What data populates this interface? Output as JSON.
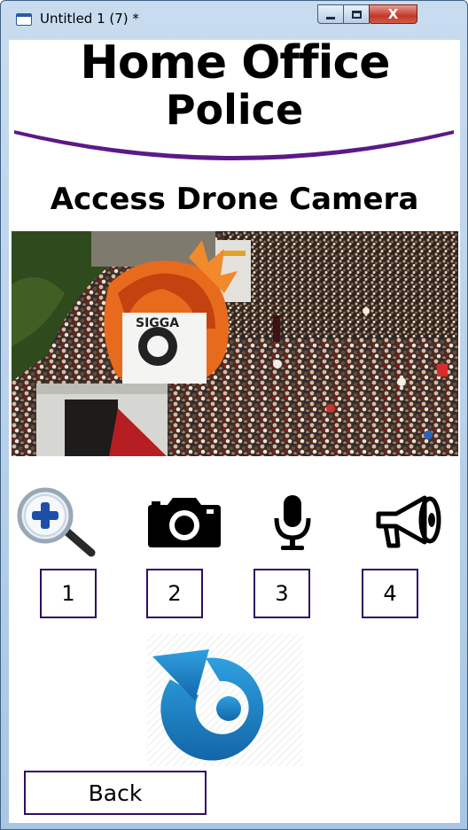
{
  "window": {
    "title": "Untitled 1 (7) *",
    "close_glyph": "X"
  },
  "header": {
    "brand_line1": "Home Office",
    "brand_line2": "Police",
    "swoosh_color": "#5b1a86"
  },
  "page": {
    "heading": "Access Drone Camera"
  },
  "feed": {
    "banner_text": "SIGGA"
  },
  "tools": [
    {
      "icon": "zoom-in-icon",
      "number": "1"
    },
    {
      "icon": "camera-icon",
      "number": "2"
    },
    {
      "icon": "microphone-icon",
      "number": "3"
    },
    {
      "icon": "megaphone-icon",
      "number": "4"
    }
  ],
  "actions": {
    "back_label": "Back"
  },
  "colors": {
    "box_border": "#2f0d63",
    "refresh_blue": "#1f86c8"
  }
}
